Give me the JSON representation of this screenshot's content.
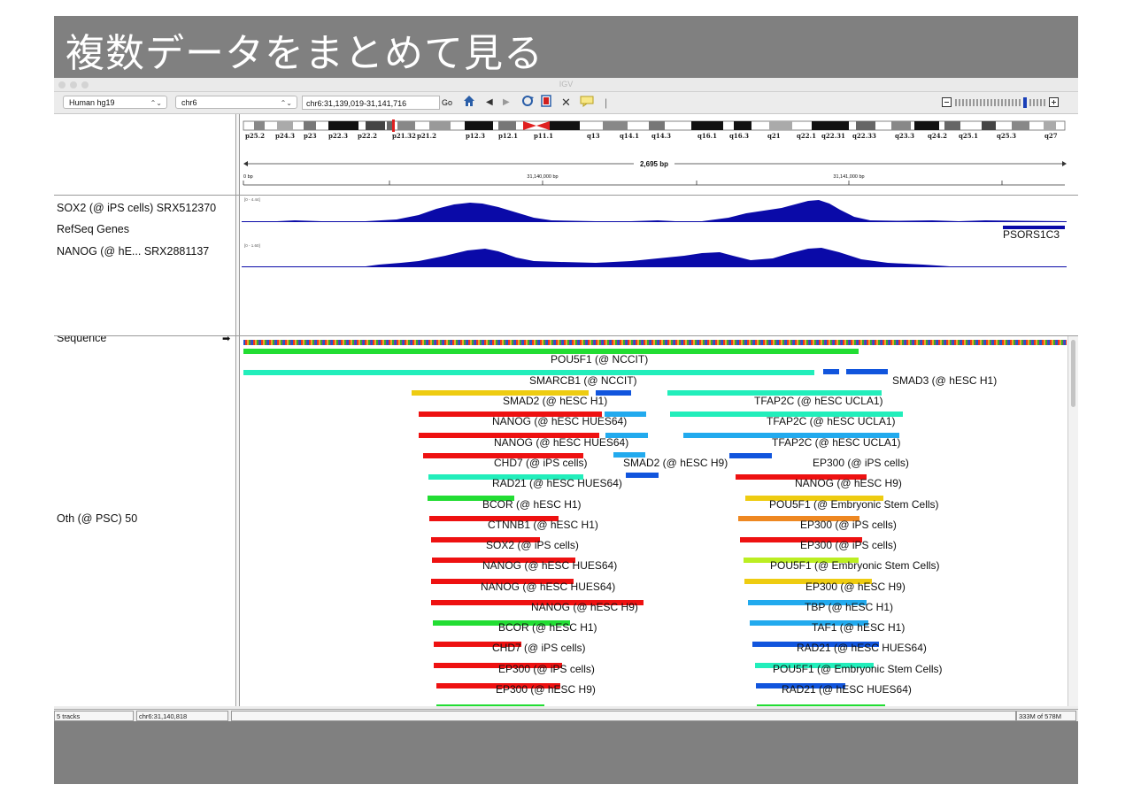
{
  "slide": {
    "title": "複数データをまとめて見る"
  },
  "window": {
    "title": "IGV"
  },
  "toolbar": {
    "genome": "Human hg19",
    "chromosome": "chr6",
    "locus": "chr6:31,139,019-31,141,716",
    "go_label": "Go"
  },
  "ideogram": {
    "bands": [
      "p25.2",
      "p24.3",
      "p23",
      "p22.3",
      "p22.2",
      "p21.32",
      "p21.2",
      "p12.3",
      "p12.1",
      "p11.1",
      "q13",
      "q14.1",
      "q14.3",
      "q16.1",
      "q16.3",
      "q21",
      "q22.1",
      "q22.31",
      "q22.33",
      "q23.3",
      "q24.2",
      "q25.1",
      "q25.3",
      "q27"
    ]
  },
  "ruler": {
    "span_label": "2,695 bp",
    "start_label": "0 bp",
    "tick_labels": [
      "31,140,000 bp",
      "31,141,000 bp"
    ]
  },
  "tracks": {
    "names": [
      "SOX2 (@ iPS cells) SRX512370",
      "RefSeq Genes",
      "NANOG (@ hE... SRX2881137"
    ],
    "sox2_range": "[0 - 4.44]",
    "nanog_range": "[0 - 1.60]",
    "gene_label": "PSORS1C3",
    "sequence_label": "Sequence",
    "sequence_arrow": "➡",
    "feature_track_label": "Oth (@ PSC) 50"
  },
  "features": {
    "labels": [
      "POU5F1 (@ NCCIT)",
      "SMARCB1 (@ NCCIT)",
      "SMAD3 (@ hESC H1)",
      "SMAD2 (@ hESC H1)",
      "TFAP2C (@ hESC UCLA1)",
      "NANOG (@ hESC HUES64)",
      "TFAP2C (@ hESC UCLA1)",
      "NANOG (@ hESC HUES64)",
      "TFAP2C (@ hESC UCLA1)",
      "CHD7 (@ iPS cells)",
      "SMAD2 (@ hESC H9)",
      "EP300 (@ iPS cells)",
      "RAD21 (@ hESC HUES64)",
      "NANOG (@ hESC H9)",
      "BCOR (@ hESC H1)",
      "POU5F1 (@ Embryonic Stem Cells)",
      "CTNNB1 (@ hESC H1)",
      "EP300 (@ iPS cells)",
      "SOX2 (@ iPS cells)",
      "EP300 (@ iPS cells)",
      "NANOG (@ hESC HUES64)",
      "POU5F1 (@ Embryonic Stem Cells)",
      "NANOG (@ hESC HUES64)",
      "EP300 (@ hESC H9)",
      "NANOG (@ hESC H9)",
      "TBP (@ hESC H1)",
      "BCOR (@ hESC H1)",
      "TAF1 (@ hESC H1)",
      "CHD7 (@ iPS cells)",
      "RAD21 (@ hESC HUES64)",
      "EP300 (@ iPS cells)",
      "POU5F1 (@ Embryonic Stem Cells)",
      "EP300 (@ hESC H9)",
      "RAD21 (@ hESC HUES64)"
    ]
  },
  "status": {
    "tracks": "5 tracks",
    "position": "chr6:31,140,818",
    "memory": "333M of 578M"
  },
  "colors": {
    "slide_bg": "#808080",
    "coverage": "#0000a8",
    "red": "#ee1111",
    "green": "#22dd33",
    "cyan": "#22eebb",
    "blue": "#1155dd",
    "lightblue": "#22aaee",
    "yellow": "#eecc11",
    "orange": "#ee8822",
    "lime": "#bbee22"
  }
}
